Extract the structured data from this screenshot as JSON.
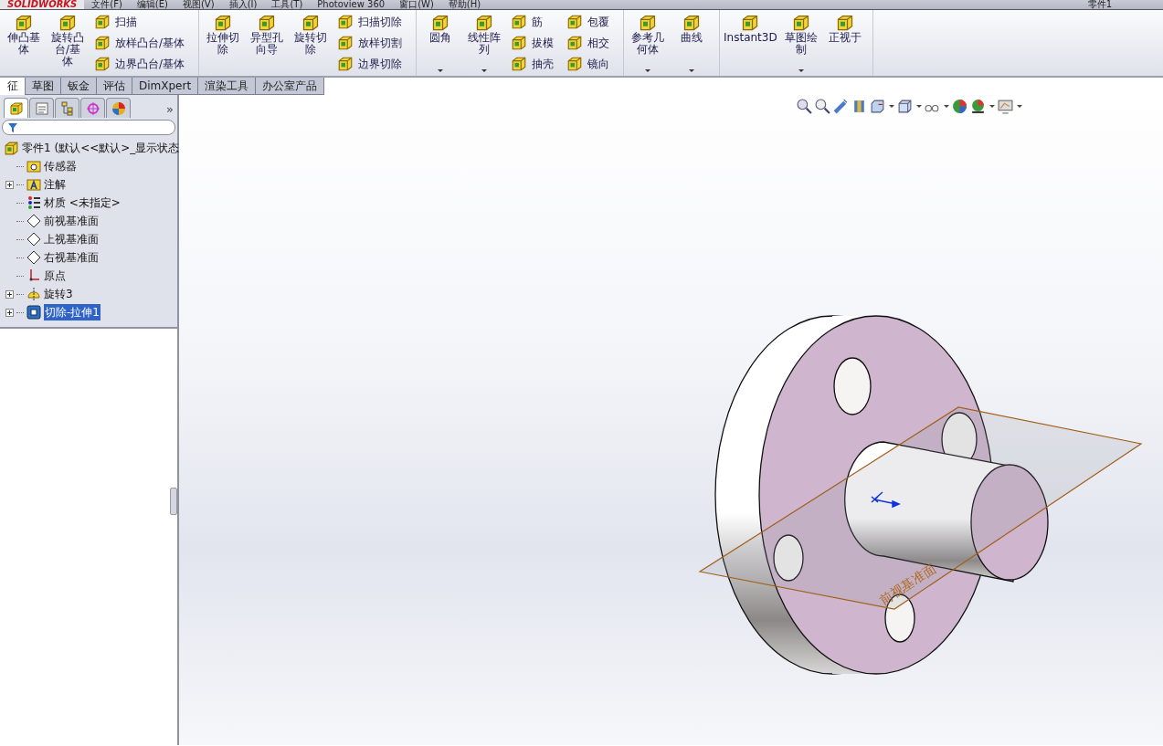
{
  "menu_bar": {
    "logo": "SOLIDWORKS",
    "items": [
      "文件(F)",
      "编辑(E)",
      "视图(V)",
      "插入(I)",
      "工具(T)",
      "Photoview 360",
      "窗口(W)",
      "帮助(H)"
    ],
    "document_title": "零件1"
  },
  "ribbon": {
    "groups": [
      {
        "items": [
          {
            "kind": "large",
            "label": "伸凸基体",
            "dropdown": false
          },
          {
            "kind": "large",
            "label": "旋转凸台/基体",
            "dropdown": false
          },
          {
            "kind": "stack",
            "labels": [
              "扫描",
              "放样凸台/基体",
              "边界凸台/基体"
            ]
          }
        ]
      },
      {
        "items": [
          {
            "kind": "large",
            "label": "拉伸切除",
            "dropdown": false
          },
          {
            "kind": "large",
            "label": "异型孔向导",
            "dropdown": false
          },
          {
            "kind": "large",
            "label": "旋转切除",
            "dropdown": false
          },
          {
            "kind": "stack",
            "labels": [
              "扫描切除",
              "放样切割",
              "边界切除"
            ]
          }
        ]
      },
      {
        "items": [
          {
            "kind": "large",
            "label": "圆角",
            "dropdown": true
          },
          {
            "kind": "large",
            "label": "线性阵列",
            "dropdown": true
          },
          {
            "kind": "stack",
            "labels": [
              "筋",
              "拔模",
              "抽壳"
            ]
          },
          {
            "kind": "stack",
            "labels": [
              "包覆",
              "相交",
              "镜向"
            ]
          }
        ]
      },
      {
        "items": [
          {
            "kind": "large",
            "label": "参考几何体",
            "dropdown": true
          },
          {
            "kind": "large",
            "label": "曲线",
            "dropdown": true
          }
        ]
      },
      {
        "items": [
          {
            "kind": "large",
            "label": "Instant3D",
            "dropdown": false
          },
          {
            "kind": "large",
            "label": "草图绘制",
            "dropdown": true
          },
          {
            "kind": "large",
            "label": "正视于",
            "dropdown": false
          }
        ]
      }
    ]
  },
  "tabs": [
    {
      "label": "征",
      "selected": true
    },
    {
      "label": "草图",
      "selected": false
    },
    {
      "label": "钣金",
      "selected": false
    },
    {
      "label": "评估",
      "selected": false
    },
    {
      "label": "DimXpert",
      "selected": false
    },
    {
      "label": "渲染工具",
      "selected": false
    },
    {
      "label": "办公室产品",
      "selected": false
    }
  ],
  "view_toolbar": [
    {
      "dropdown": false
    },
    {
      "dropdown": false
    },
    {
      "dropdown": false
    },
    {
      "dropdown": false
    },
    {
      "dropdown": true
    },
    {
      "dropdown": true
    },
    {
      "dropdown": true
    },
    {
      "dropdown": false
    },
    {
      "dropdown": true
    },
    {
      "dropdown": true
    }
  ],
  "feature_manager": {
    "panel_tabs": [
      {
        "selected": true
      },
      {
        "selected": false
      },
      {
        "selected": false
      },
      {
        "selected": false
      },
      {
        "selected": false
      }
    ],
    "more": "»",
    "tree": {
      "label": "零件1  (默认<<默认>_显示状态",
      "children": [
        {
          "kind": "folder",
          "label": "传感器",
          "expandable": false,
          "selected": false
        },
        {
          "kind": "annotation",
          "label": "注解",
          "expandable": true,
          "selected": false
        },
        {
          "kind": "material",
          "label": "材质 <未指定>",
          "expandable": false,
          "selected": false
        },
        {
          "kind": "plane",
          "label": "前视基准面",
          "expandable": false,
          "selected": false
        },
        {
          "kind": "plane",
          "label": "上视基准面",
          "expandable": false,
          "selected": false
        },
        {
          "kind": "plane",
          "label": "右视基准面",
          "expandable": false,
          "selected": false
        },
        {
          "kind": "origin",
          "label": "原点",
          "expandable": false,
          "selected": false
        },
        {
          "kind": "revolve",
          "label": "旋转3",
          "expandable": true,
          "selected": false
        },
        {
          "kind": "cut",
          "label": "切除-拉伸1",
          "expandable": true,
          "selected": true
        }
      ]
    }
  },
  "viewport": {
    "plane_label": "前视基准面"
  }
}
